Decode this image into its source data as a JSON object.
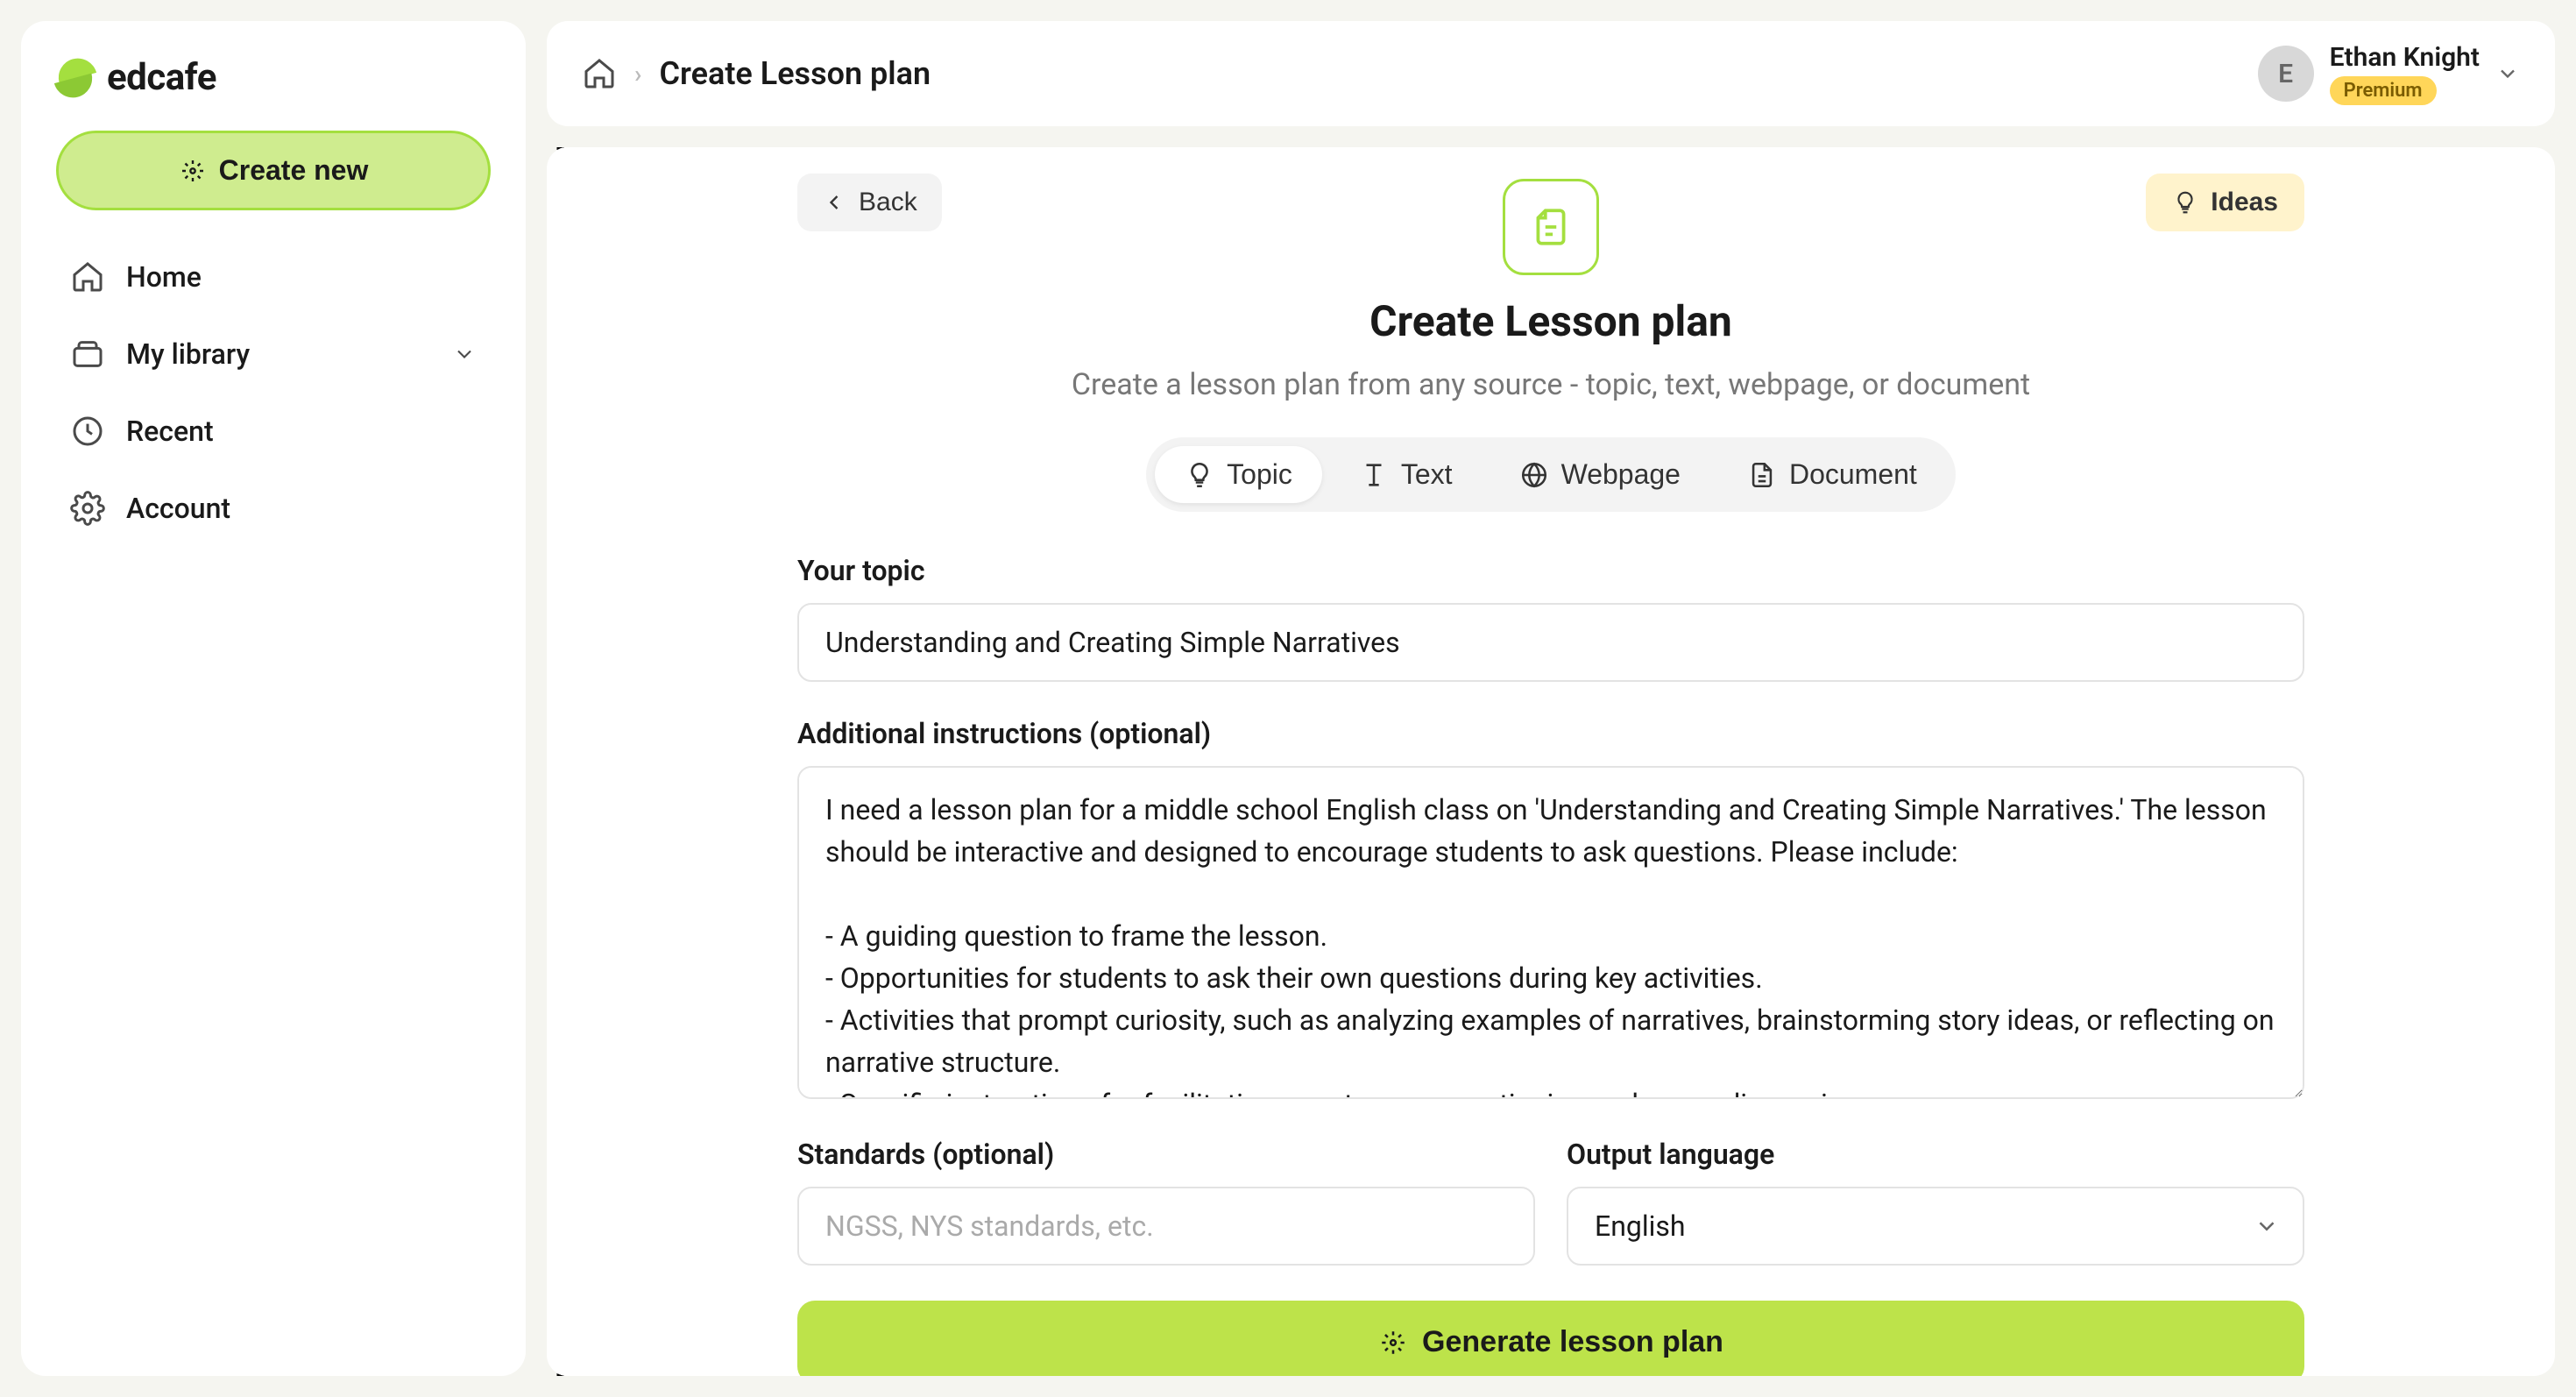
{
  "brand": "edcafe",
  "sidebar": {
    "create_label": "Create new",
    "items": [
      {
        "label": "Home"
      },
      {
        "label": "My library"
      },
      {
        "label": "Recent"
      },
      {
        "label": "Account"
      }
    ]
  },
  "breadcrumb": {
    "page": "Create Lesson plan"
  },
  "user": {
    "initial": "E",
    "name": "Ethan Knight",
    "badge": "Premium"
  },
  "actions": {
    "back": "Back",
    "ideas": "Ideas",
    "generate": "Generate lesson plan"
  },
  "hero": {
    "title": "Create Lesson plan",
    "subtitle": "Create a lesson plan from any source - topic, text, webpage, or document"
  },
  "tabs": [
    {
      "label": "Topic"
    },
    {
      "label": "Text"
    },
    {
      "label": "Webpage"
    },
    {
      "label": "Document"
    }
  ],
  "form": {
    "topic_label": "Your topic",
    "topic_value": "Understanding and Creating Simple Narratives",
    "instructions_label": "Additional instructions (optional)",
    "instructions_value": "I need a lesson plan for a middle school English class on 'Understanding and Creating Simple Narratives.' The lesson should be interactive and designed to encourage students to ask questions. Please include:\n\n- A guiding question to frame the lesson.\n- Opportunities for students to ask their own questions during key activities.\n- Activities that prompt curiosity, such as analyzing examples of narratives, brainstorming story ideas, or reflecting on narrative structure.\n- Specific instructions for facilitating peer-to-peer questioning and group discussions.\n- A reflective exercise where students pose questions about their narratives or their classmates' stories.",
    "standards_label": "Standards (optional)",
    "standards_placeholder": "NGSS, NYS standards, etc.",
    "language_label": "Output language",
    "language_value": "English"
  }
}
